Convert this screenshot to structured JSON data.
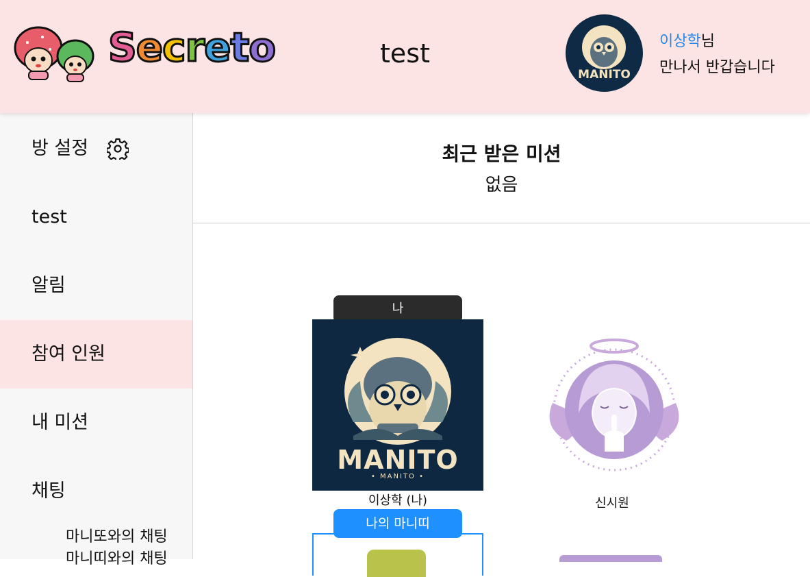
{
  "header": {
    "brand": "Secreto",
    "room_title": "test",
    "user_name": "이상학",
    "user_suffix": "님",
    "greeting": "만나서 반갑습니다",
    "avatar_text": "MANITO"
  },
  "sidebar": {
    "items": [
      {
        "label": "방 설정"
      },
      {
        "label": "test"
      },
      {
        "label": "알림"
      },
      {
        "label": "참여 인원"
      },
      {
        "label": "내 미션"
      },
      {
        "label": "채팅"
      }
    ],
    "chat_sub": [
      "마니또와의 채팅",
      "마니띠와의 채팅"
    ]
  },
  "mission": {
    "title": "최근 받은 미션",
    "value": "없음"
  },
  "members": {
    "me_tag": "나",
    "me_name": "이상학 (나)",
    "me_logo_text": "MANITO",
    "me_logo_sub": "• MANITO •",
    "other_name": "신시원",
    "manitti_tag": "나의 마니띠"
  },
  "colors": {
    "header_bg": "#fde4e4",
    "accent_blue": "#1e90ff",
    "name_blue": "#2b87e6",
    "active_bg": "#fde4e4"
  }
}
